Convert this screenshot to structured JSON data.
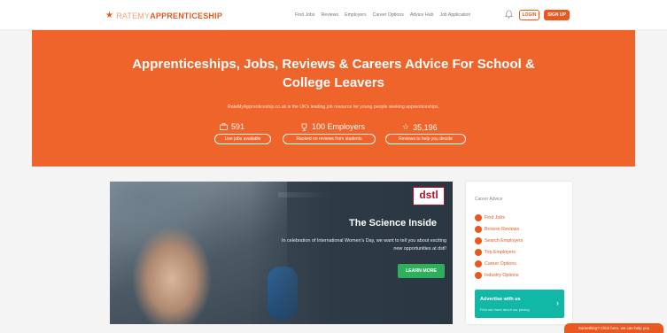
{
  "brand": {
    "prefix": "RATEMY",
    "name": "APPRENTICESHIP",
    "accent": "#e8581f"
  },
  "nav": {
    "items": [
      "Find Jobs",
      "Reviews",
      "Employers",
      "Career Options",
      "Advice Hub",
      "Job Application"
    ],
    "login_label": "LOGIN",
    "signup_label": "SIGN UP"
  },
  "hero": {
    "title": "Apprenticeships, Jobs, Reviews & Careers Advice For School & College Leavers",
    "subtitle": "RateMyApprenticeship.co.uk is the UK's leading job resource for young people seeking apprenticeships.",
    "stats": [
      {
        "icon": "briefcase-icon",
        "value": "591",
        "pill": "Live jobs available"
      },
      {
        "icon": "trophy-icon",
        "value": "100 Employers",
        "pill": "Ranked on reviews from students"
      },
      {
        "icon": "star-icon",
        "value": "35,196",
        "pill": "Reviews to help you decide"
      }
    ]
  },
  "feature": {
    "logo": "dstl",
    "title": "The Science Inside",
    "text": "In celebration of International Women's Day, we want to tell you about exciting new opportunities at dstl!",
    "button": "LEARN MORE"
  },
  "sidebar": {
    "heading": "Career Advice",
    "items": [
      "Find Jobs",
      "Browse Reviews",
      "Search Employers",
      "Top Employers",
      "Career Options",
      "Industry Options"
    ],
    "advertise_title": "Advertise with us",
    "advertise_sub": "Find out more about our pricing"
  },
  "chat": {
    "label": "Something? Click here, we can help you"
  }
}
